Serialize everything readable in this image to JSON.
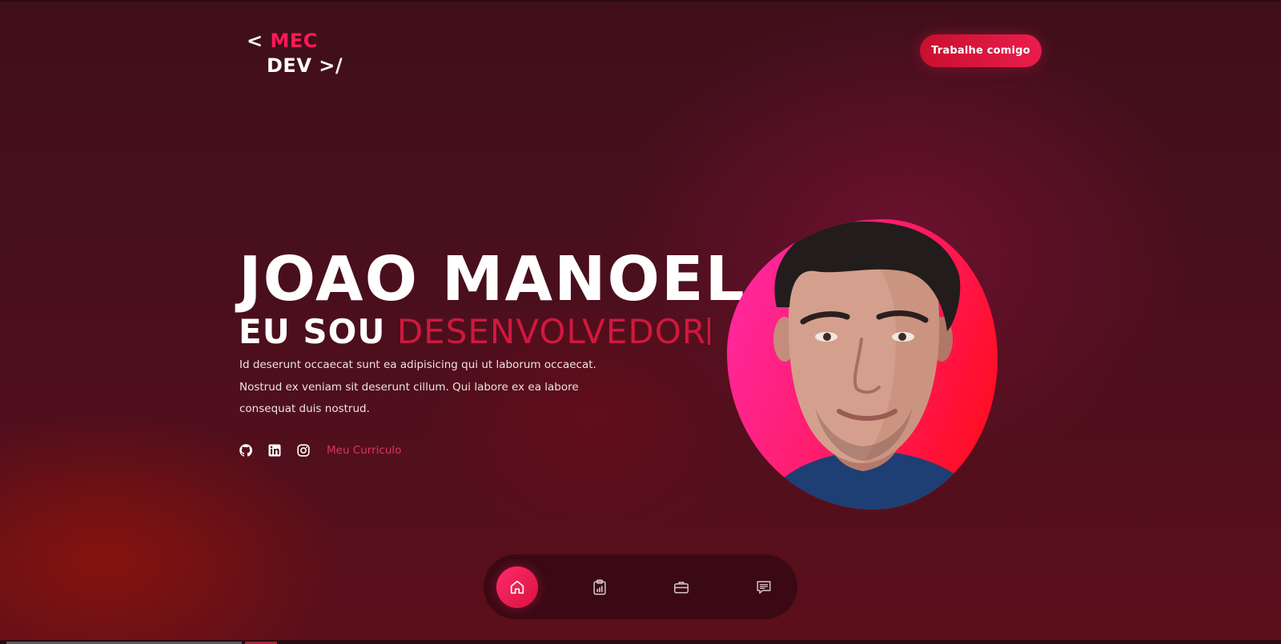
{
  "brand": {
    "logo_prefix": "<",
    "logo_accent": "MEC",
    "logo_line2": "DEV >/",
    "accent_color": "#ff1a55"
  },
  "header": {
    "cta_label": "Trabalhe comigo"
  },
  "hero": {
    "name": "JOAO MANOEL",
    "role_prefix": "EU SOU",
    "role_word": "DESENVOLVEDOR",
    "description_lines": [
      "Id deserunt occaecat sunt ea adipisicing qui ut laborum occaecat.",
      "Nostrud ex veniam sit deserunt cillum. Qui labore ex ea labore",
      "consequat duis nostrud."
    ],
    "socials": [
      {
        "icon": "github-icon"
      },
      {
        "icon": "linkedin-icon"
      },
      {
        "icon": "instagram-icon"
      }
    ],
    "resume_link": "Meu Curriculo",
    "highlight_color": "#d0183d"
  },
  "portrait": {
    "icon": "profile-photo"
  },
  "bottom_nav": {
    "items": [
      {
        "icon": "home-icon",
        "active": true
      },
      {
        "icon": "clipboard-chart-icon",
        "active": false
      },
      {
        "icon": "briefcase-icon",
        "active": false
      },
      {
        "icon": "chat-icon",
        "active": false
      }
    ]
  }
}
